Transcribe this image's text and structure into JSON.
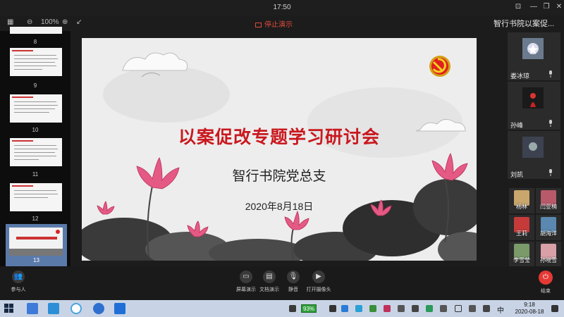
{
  "window": {
    "time": "17:50"
  },
  "toolbar": {
    "zoom": "100%",
    "stop_share": "停止演示",
    "meeting_title": "智行书院以案促..."
  },
  "thumbnails": [
    {
      "number": "8"
    },
    {
      "number": "9"
    },
    {
      "number": "10"
    },
    {
      "number": "11"
    },
    {
      "number": "12"
    },
    {
      "number": "13"
    }
  ],
  "slide": {
    "title": "以案促改专题学习研讨会",
    "subtitle": "智行书院党总支",
    "date": "2020年8月18日"
  },
  "participants_main": [
    {
      "name": "娄冰琼"
    },
    {
      "name": "孙峰"
    },
    {
      "name": "刘凯"
    }
  ],
  "participants_small": [
    {
      "name": "杨林"
    },
    {
      "name": "闫亚楠"
    },
    {
      "name": "王莉"
    },
    {
      "name": "胡海洋"
    },
    {
      "name": "李雪莹"
    },
    {
      "name": "孙晓雪"
    },
    {
      "name": ""
    }
  ],
  "bottombar": {
    "participants": "参与人",
    "screen_share": "屏幕演示",
    "doc_share": "文档演示",
    "mute": "静音",
    "camera": "打开摄像头",
    "leave": "结束"
  },
  "taskbar": {
    "battery": "93%",
    "lang": "中",
    "clock_time": "9:18",
    "clock_date": "2020-08-18"
  },
  "colors": {
    "accent_red": "#e53935",
    "title_red": "#c9181e",
    "selected_thumb": "#5a7aaa"
  }
}
